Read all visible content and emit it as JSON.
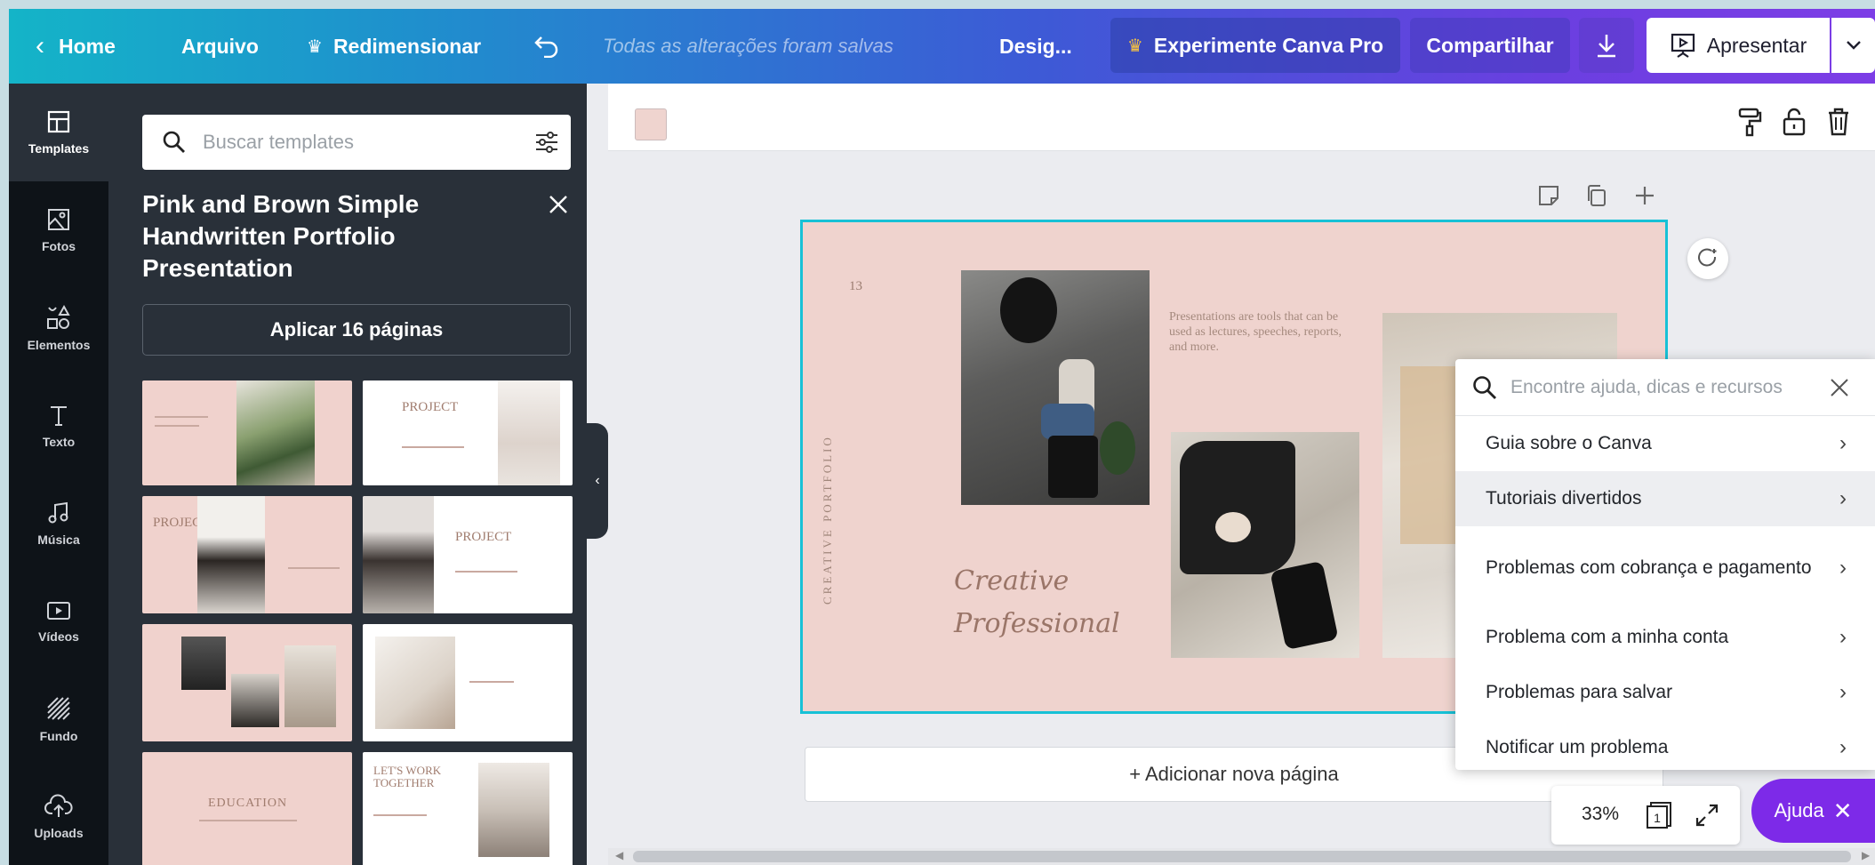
{
  "topbar": {
    "home_label": "Home",
    "file_label": "Arquivo",
    "resize_label": "Redimensionar",
    "saved_status": "Todas as alterações foram salvas",
    "design_label": "Desig...",
    "pro_label": "Experimente Canva Pro",
    "share_label": "Compartilhar",
    "present_label": "Apresentar"
  },
  "rail": {
    "items": [
      {
        "label": "Templates"
      },
      {
        "label": "Fotos"
      },
      {
        "label": "Elementos"
      },
      {
        "label": "Texto"
      },
      {
        "label": "Música"
      },
      {
        "label": "Vídeos"
      },
      {
        "label": "Fundo"
      },
      {
        "label": "Uploads"
      }
    ]
  },
  "panel": {
    "search_placeholder": "Buscar templates",
    "template_title": "Pink and Brown Simple Handwritten Portfolio Presentation",
    "apply_label": "Aplicar 16 páginas",
    "thumbs": {
      "t2_title": "PROJECT",
      "t3_title": "PROJECT",
      "t4_title": "PROJECT",
      "t7_title": "EDUCATION",
      "t8_title": "LET'S WORK TOGETHER"
    }
  },
  "slide": {
    "number": "13",
    "vertical_text": "CREATIVE PORTFOLIO",
    "description": "Presentations are tools that can be used as lectures, speeches, reports, and more.",
    "script_line1": "Creative",
    "script_line2": "Professional",
    "colors": {
      "background": "#efd3ce",
      "selection": "#17c1d6"
    }
  },
  "canvas": {
    "add_page_label": "+ Adicionar nova página",
    "zoom": "33%",
    "page_count": "1"
  },
  "help": {
    "search_placeholder": "Encontre ajuda, dicas e recursos",
    "items": [
      {
        "label": "Guia sobre o Canva"
      },
      {
        "label": "Tutoriais divertidos"
      },
      {
        "label": "Problemas com cobrança e pagamento"
      },
      {
        "label": "Problema com a minha conta"
      },
      {
        "label": "Problemas para salvar"
      },
      {
        "label": "Notificar um problema"
      }
    ],
    "button_label": "Ajuda"
  },
  "colors": {
    "accent": "#7d2ae8",
    "panel": "#293039",
    "rail": "#0e1318"
  }
}
